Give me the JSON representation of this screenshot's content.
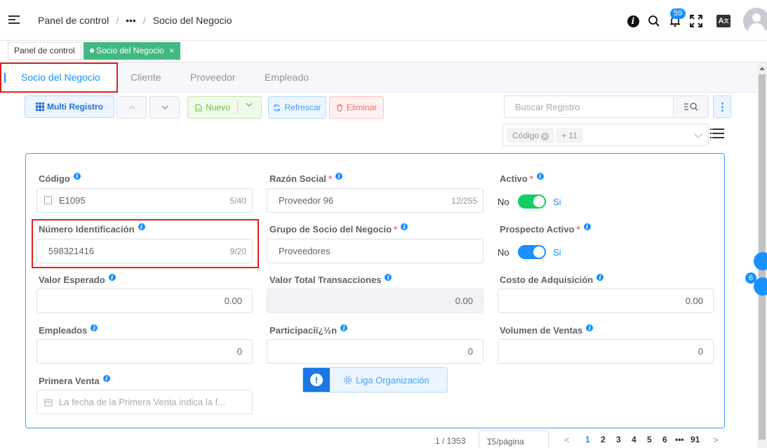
{
  "header": {
    "breadcrumb": [
      "Panel de control",
      "•••",
      "Socio del Negocio"
    ],
    "notification_count": "59",
    "lang_label": "A"
  },
  "tagbar": {
    "tags": [
      {
        "label": "Panel de control"
      },
      {
        "label": "Socio del Negocio",
        "close": "×"
      }
    ]
  },
  "tabs": [
    {
      "label": "Socio del Negocio"
    },
    {
      "label": "Cliente"
    },
    {
      "label": "Proveedor"
    },
    {
      "label": "Empleado"
    }
  ],
  "toolbar": {
    "multi_label": "Multi Registro",
    "new_label": "Nuevo",
    "refresh_label": "Refrescar",
    "delete_label": "Eliminar",
    "search_placeholder": "Buscar Registro",
    "chip_label": "Código",
    "chip_more": "+ 11"
  },
  "form": {
    "codigo": {
      "label": "Código",
      "value": "E1095",
      "count": "5/40"
    },
    "razon_social": {
      "label": "Razón Social",
      "value": "Proveedor 96",
      "count": "12/255"
    },
    "activo": {
      "label": "Activo",
      "off": "No",
      "on": "Si"
    },
    "numero_id": {
      "label": "Número Identificación",
      "value": "598321416",
      "count": "9/20"
    },
    "grupo": {
      "label": "Grupo de Socio del Negocio",
      "value": "Proveedores"
    },
    "prospecto": {
      "label": "Prospecto Activo",
      "off": "No",
      "on": "Si"
    },
    "valor_esperado": {
      "label": "Valor Esperado",
      "value": "0.00"
    },
    "valor_total": {
      "label": "Valor Total Transacciones",
      "value": "0.00"
    },
    "costo": {
      "label": "Costo de Adquisición",
      "value": "0.00"
    },
    "empleados": {
      "label": "Empleados",
      "value": "0"
    },
    "participacion": {
      "label": "Participaciï¿½n",
      "value": "0"
    },
    "volumen": {
      "label": "Volumen de Ventas",
      "value": "0"
    },
    "primera_venta": {
      "label": "Primera Venta",
      "placeholder": "La fecha de la Primera Venta indica la f..."
    },
    "liga_label": "Liga Organización"
  },
  "side": {
    "badge": "6"
  },
  "pagination": {
    "total": "1 / 1353",
    "page_size": "15/página",
    "pages": [
      "1",
      "2",
      "3",
      "4",
      "5",
      "6",
      "•••",
      "91"
    ]
  },
  "colors": {
    "accent": "#1890ff",
    "success": "#42b983",
    "switch_on_green": "#13ce66",
    "danger": "#e02020"
  }
}
